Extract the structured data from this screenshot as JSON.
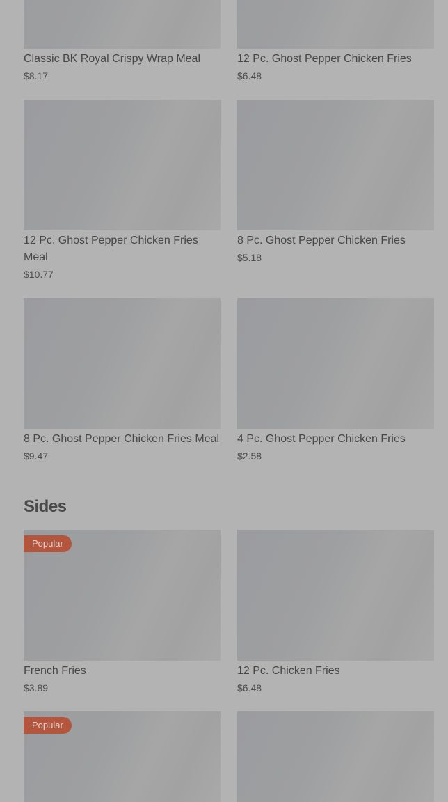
{
  "rows": [
    {
      "items": [
        {
          "name": "Classic BK Royal Crispy Wrap Meal",
          "price": "$8.17"
        },
        {
          "name": "12 Pc. Ghost Pepper Chicken Fries",
          "price": "$6.48"
        }
      ]
    },
    {
      "items": [
        {
          "name": "12 Pc. Ghost Pepper Chicken Fries Meal",
          "price": "$10.77"
        },
        {
          "name": "8 Pc. Ghost Pepper Chicken Fries",
          "price": "$5.18"
        }
      ]
    },
    {
      "items": [
        {
          "name": "8 Pc. Ghost Pepper Chicken Fries Meal",
          "price": "$9.47"
        },
        {
          "name": "4 Pc. Ghost Pepper Chicken Fries",
          "price": "$2.58"
        }
      ]
    }
  ],
  "sides": {
    "title": "Sides",
    "rows": [
      {
        "items": [
          {
            "name": "French Fries",
            "price": "$3.89",
            "badge": "Popular"
          },
          {
            "name": "12 Pc. Chicken Fries",
            "price": "$6.48"
          }
        ]
      },
      {
        "items": [
          {
            "badge": "Popular"
          },
          {}
        ]
      }
    ]
  },
  "colors": {
    "overlay": "#b3b3b3",
    "badge": "#b4553e",
    "text": "#474747"
  }
}
